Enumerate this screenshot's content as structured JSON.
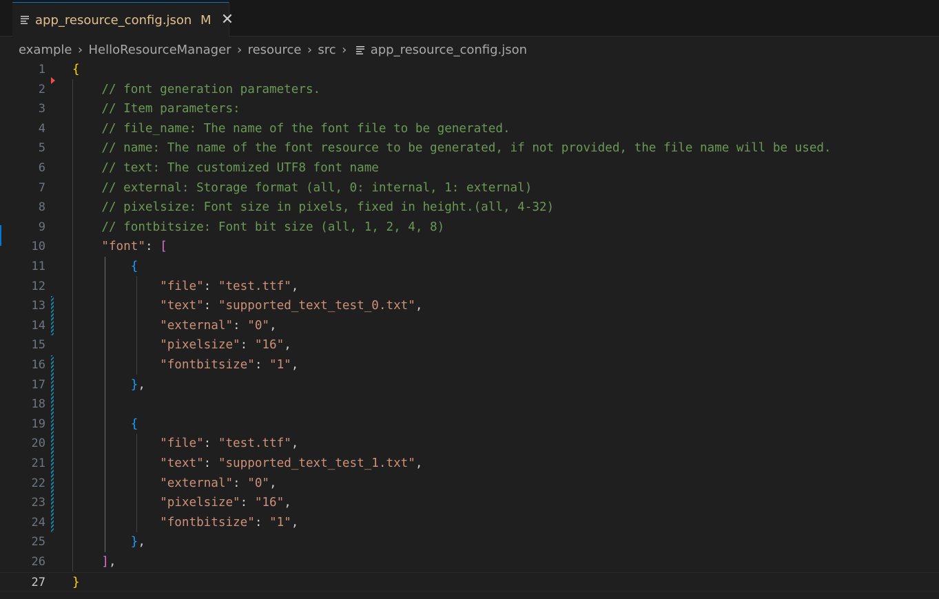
{
  "tab": {
    "title": "app_resource_config.json",
    "badge": "M",
    "close_icon": "close-icon",
    "file_icon": "json-file-icon"
  },
  "breadcrumb": [
    "example",
    "HelloResourceManager",
    "resource",
    "src",
    "app_resource_config.json"
  ],
  "editor": {
    "active_line": 27,
    "lines": [
      {
        "n": "1",
        "tokens": [
          [
            "c-brace1",
            "{"
          ]
        ]
      },
      {
        "n": "2",
        "tokens": [
          [
            "c-punc",
            "    "
          ],
          [
            "c-comment",
            "// font generation parameters."
          ]
        ]
      },
      {
        "n": "3",
        "tokens": [
          [
            "c-punc",
            "    "
          ],
          [
            "c-comment",
            "// Item parameters:"
          ]
        ]
      },
      {
        "n": "4",
        "tokens": [
          [
            "c-punc",
            "    "
          ],
          [
            "c-comment",
            "// file_name: The name of the font file to be generated."
          ]
        ]
      },
      {
        "n": "5",
        "tokens": [
          [
            "c-punc",
            "    "
          ],
          [
            "c-comment",
            "// name: The name of the font resource to be generated, if not provided, the file name will be used."
          ]
        ]
      },
      {
        "n": "6",
        "tokens": [
          [
            "c-punc",
            "    "
          ],
          [
            "c-comment",
            "// text: The customized UTF8 font name"
          ]
        ]
      },
      {
        "n": "7",
        "tokens": [
          [
            "c-punc",
            "    "
          ],
          [
            "c-comment",
            "// external: Storage format (all, 0: internal, 1: external)"
          ]
        ]
      },
      {
        "n": "8",
        "tokens": [
          [
            "c-punc",
            "    "
          ],
          [
            "c-comment",
            "// pixelsize: Font size in pixels, fixed in height.(all, 4-32)"
          ]
        ]
      },
      {
        "n": "9",
        "tokens": [
          [
            "c-punc",
            "    "
          ],
          [
            "c-comment",
            "// fontbitsize: Font bit size (all, 1, 2, 4, 8)"
          ]
        ]
      },
      {
        "n": "10",
        "tokens": [
          [
            "c-punc",
            "    "
          ],
          [
            "c-key",
            "\"font\""
          ],
          [
            "c-punc",
            ": "
          ],
          [
            "c-brace2",
            "["
          ]
        ]
      },
      {
        "n": "11",
        "tokens": [
          [
            "c-punc",
            "        "
          ],
          [
            "c-brace3",
            "{"
          ]
        ]
      },
      {
        "n": "12",
        "tokens": [
          [
            "c-punc",
            "            "
          ],
          [
            "c-key",
            "\"file\""
          ],
          [
            "c-punc",
            ": "
          ],
          [
            "c-str",
            "\"test.ttf\""
          ],
          [
            "c-punc",
            ","
          ]
        ]
      },
      {
        "n": "13",
        "tokens": [
          [
            "c-punc",
            "            "
          ],
          [
            "c-key",
            "\"text\""
          ],
          [
            "c-punc",
            ": "
          ],
          [
            "c-str",
            "\"supported_text_test_0.txt\""
          ],
          [
            "c-punc",
            ","
          ]
        ]
      },
      {
        "n": "14",
        "tokens": [
          [
            "c-punc",
            "            "
          ],
          [
            "c-key",
            "\"external\""
          ],
          [
            "c-punc",
            ": "
          ],
          [
            "c-str",
            "\"0\""
          ],
          [
            "c-punc",
            ","
          ]
        ]
      },
      {
        "n": "15",
        "tokens": [
          [
            "c-punc",
            "            "
          ],
          [
            "c-key",
            "\"pixelsize\""
          ],
          [
            "c-punc",
            ": "
          ],
          [
            "c-str",
            "\"16\""
          ],
          [
            "c-punc",
            ","
          ]
        ]
      },
      {
        "n": "16",
        "tokens": [
          [
            "c-punc",
            "            "
          ],
          [
            "c-key",
            "\"fontbitsize\""
          ],
          [
            "c-punc",
            ": "
          ],
          [
            "c-str",
            "\"1\""
          ],
          [
            "c-punc",
            ","
          ]
        ]
      },
      {
        "n": "17",
        "tokens": [
          [
            "c-punc",
            "        "
          ],
          [
            "c-brace3",
            "}"
          ],
          [
            "c-punc",
            ","
          ]
        ]
      },
      {
        "n": "18",
        "tokens": []
      },
      {
        "n": "19",
        "tokens": [
          [
            "c-punc",
            "        "
          ],
          [
            "c-brace3",
            "{"
          ]
        ]
      },
      {
        "n": "20",
        "tokens": [
          [
            "c-punc",
            "            "
          ],
          [
            "c-key",
            "\"file\""
          ],
          [
            "c-punc",
            ": "
          ],
          [
            "c-str",
            "\"test.ttf\""
          ],
          [
            "c-punc",
            ","
          ]
        ]
      },
      {
        "n": "21",
        "tokens": [
          [
            "c-punc",
            "            "
          ],
          [
            "c-key",
            "\"text\""
          ],
          [
            "c-punc",
            ": "
          ],
          [
            "c-str",
            "\"supported_text_test_1.txt\""
          ],
          [
            "c-punc",
            ","
          ]
        ]
      },
      {
        "n": "22",
        "tokens": [
          [
            "c-punc",
            "            "
          ],
          [
            "c-key",
            "\"external\""
          ],
          [
            "c-punc",
            ": "
          ],
          [
            "c-str",
            "\"0\""
          ],
          [
            "c-punc",
            ","
          ]
        ]
      },
      {
        "n": "23",
        "tokens": [
          [
            "c-punc",
            "            "
          ],
          [
            "c-key",
            "\"pixelsize\""
          ],
          [
            "c-punc",
            ": "
          ],
          [
            "c-str",
            "\"16\""
          ],
          [
            "c-punc",
            ","
          ]
        ]
      },
      {
        "n": "24",
        "tokens": [
          [
            "c-punc",
            "            "
          ],
          [
            "c-key",
            "\"fontbitsize\""
          ],
          [
            "c-punc",
            ": "
          ],
          [
            "c-str",
            "\"1\""
          ],
          [
            "c-punc",
            ","
          ]
        ]
      },
      {
        "n": "25",
        "tokens": [
          [
            "c-punc",
            "        "
          ],
          [
            "c-brace3",
            "}"
          ],
          [
            "c-punc",
            ","
          ]
        ]
      },
      {
        "n": "26",
        "tokens": [
          [
            "c-punc",
            "    "
          ],
          [
            "c-brace2",
            "]"
          ],
          [
            "c-punc",
            ","
          ]
        ]
      },
      {
        "n": "27",
        "tokens": [
          [
            "c-brace1",
            "}"
          ]
        ]
      }
    ]
  },
  "colors": {
    "background": "#1f1f1f",
    "comment": "#6a9955",
    "string": "#ce9178",
    "brace_level1": "#ffd700",
    "brace_level2": "#da70d6",
    "brace_level3": "#179fff",
    "modified_tab": "#e2c08d",
    "accent": "#0078d4"
  }
}
